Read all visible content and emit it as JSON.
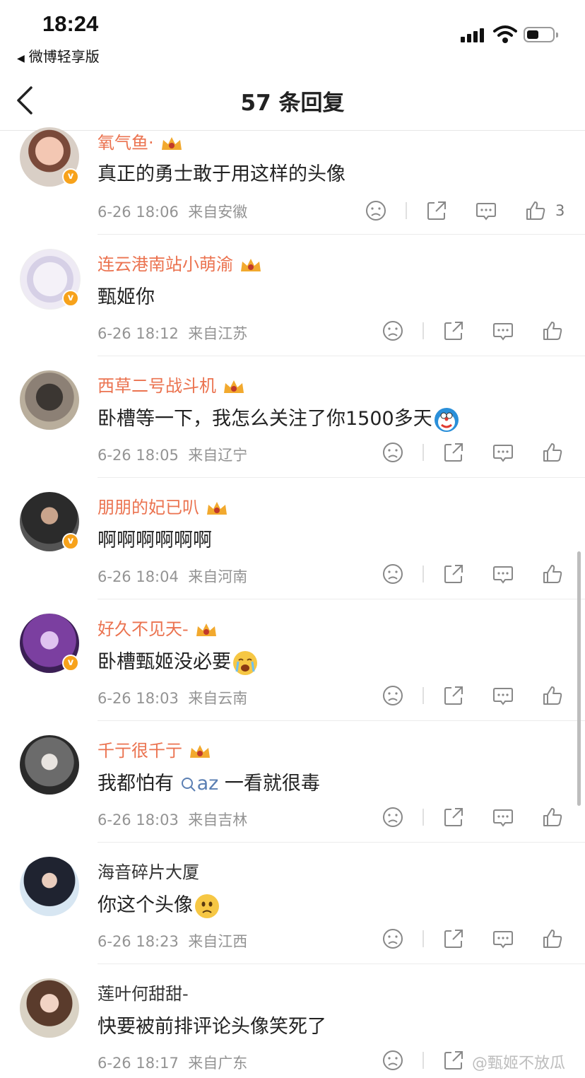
{
  "status": {
    "time": "18:24",
    "back_app": "微博轻享版"
  },
  "nav": {
    "title": "57 条回复"
  },
  "colors": {
    "username": "#eb7350",
    "meta": "#939393",
    "badge": "#f7a21b",
    "link": "#5b7fb3"
  },
  "comments": [
    {
      "username": "氧气鱼·",
      "vip": true,
      "verified": true,
      "text": "真正的勇士敢于用这样的头像",
      "date": "6-26 18:06",
      "location": "来自安徽",
      "likes": "3"
    },
    {
      "username": "连云港南站小萌渝",
      "vip": true,
      "verified": true,
      "text": "甄姬你",
      "date": "6-26 18:12",
      "location": "来自江苏",
      "likes": ""
    },
    {
      "username": "西草二号战斗机",
      "vip": true,
      "verified": false,
      "text": "卧槽等一下，我怎么关注了你1500多天",
      "emoji": "doraemon-face",
      "date": "6-26 18:05",
      "location": "来自辽宁",
      "likes": ""
    },
    {
      "username": "朋朋的妃已叭",
      "vip": true,
      "verified": true,
      "text": "啊啊啊啊啊啊",
      "date": "6-26 18:04",
      "location": "来自河南",
      "likes": ""
    },
    {
      "username": "好久不见天-",
      "vip": true,
      "verified": true,
      "text": "卧槽甄姬没必要",
      "emoji": "crying-face",
      "date": "6-26 18:03",
      "location": "来自云南",
      "likes": ""
    },
    {
      "username": "千亍很千亍",
      "vip": true,
      "verified": false,
      "text_before": "我都怕有",
      "link": "az",
      "text_after": "一看就很毒",
      "date": "6-26 18:03",
      "location": "来自吉林",
      "likes": ""
    },
    {
      "username": "海音碎片大厦",
      "vip": false,
      "verified": false,
      "text": "你这个头像",
      "emoji": "sad-face",
      "date": "6-26 18:23",
      "location": "来自江西",
      "likes": ""
    },
    {
      "username": "莲叶何甜甜-",
      "vip": false,
      "verified": false,
      "text": "快要被前排评论头像笑死了",
      "date": "6-26 18:17",
      "location": "来自广东",
      "likes": ""
    }
  ],
  "watermark": "@甄姬不放瓜"
}
